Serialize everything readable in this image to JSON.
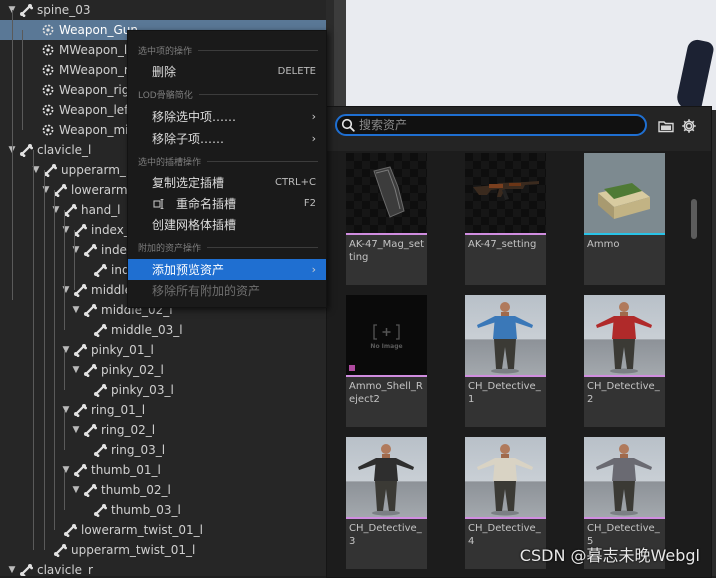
{
  "tree": {
    "rows": [
      {
        "label": "spine_03",
        "caret": "▼"
      },
      {
        "label": "Weapon_Gun",
        "caret": ""
      },
      {
        "label": "MWeapon_lef",
        "caret": ""
      },
      {
        "label": "MWeapon_mi",
        "caret": ""
      },
      {
        "label": "Weapon_right",
        "caret": ""
      },
      {
        "label": "Weapon_leftE",
        "caret": ""
      },
      {
        "label": "Weapon_midE",
        "caret": ""
      },
      {
        "label": "clavicle_l",
        "caret": "▼"
      },
      {
        "label": "upperarm_l",
        "caret": "▼"
      },
      {
        "label": "lowerarm",
        "caret": "▼"
      },
      {
        "label": "hand_l",
        "caret": "▼"
      },
      {
        "label": "index_",
        "caret": "▼"
      },
      {
        "label": "inde",
        "caret": "▼"
      },
      {
        "label": "ind",
        "caret": ""
      },
      {
        "label": "middle",
        "caret": "▼"
      },
      {
        "label": "middle_02_l",
        "caret": "▼"
      },
      {
        "label": "middle_03_l",
        "caret": ""
      },
      {
        "label": "pinky_01_l",
        "caret": "▼"
      },
      {
        "label": "pinky_02_l",
        "caret": "▼"
      },
      {
        "label": "pinky_03_l",
        "caret": ""
      },
      {
        "label": "ring_01_l",
        "caret": "▼"
      },
      {
        "label": "ring_02_l",
        "caret": "▼"
      },
      {
        "label": "ring_03_l",
        "caret": ""
      },
      {
        "label": "thumb_01_l",
        "caret": "▼"
      },
      {
        "label": "thumb_02_l",
        "caret": "▼"
      },
      {
        "label": "thumb_03_l",
        "caret": ""
      },
      {
        "label": "lowerarm_twist_01_l",
        "caret": ""
      },
      {
        "label": "upperarm_twist_01_l",
        "caret": ""
      },
      {
        "label": "clavicle_r",
        "caret": "▼"
      }
    ]
  },
  "context_menu": {
    "sections": [
      {
        "title": "选中项的操作"
      },
      {
        "title": "LOD骨骼简化"
      },
      {
        "title": "选中的插槽操作"
      },
      {
        "title": "附加的资产操作"
      }
    ],
    "items": [
      {
        "label": "删除",
        "shortcut": "DELETE",
        "arrow": ""
      },
      {
        "label": "移除选中项……",
        "shortcut": "",
        "arrow": "›"
      },
      {
        "label": "移除子项……",
        "shortcut": "",
        "arrow": "›"
      },
      {
        "label": "复制选定插槽",
        "shortcut": "CTRL+C",
        "arrow": ""
      },
      {
        "label": "重命名插槽",
        "shortcut": "F2",
        "arrow": ""
      },
      {
        "label": "创建网格体插槽",
        "shortcut": "",
        "arrow": ""
      },
      {
        "label": "添加预览资产",
        "shortcut": "",
        "arrow": "›"
      },
      {
        "label": "移除所有附加的资产",
        "shortcut": "",
        "arrow": ""
      }
    ]
  },
  "asset_picker": {
    "search": {
      "placeholder": "搜索资产",
      "value": ""
    },
    "icons": {
      "search": "search-icon",
      "folder": "folder-icon",
      "settings": "gear-icon"
    },
    "assets": [
      {
        "label": "AK-47_Mag_setting",
        "thumb": "magazine",
        "accent": "#d08de0"
      },
      {
        "label": "AK-47_setting",
        "thumb": "rifle",
        "accent": "#d08de0"
      },
      {
        "label": "Ammo",
        "thumb": "ammo-box",
        "accent": "#29c3e8"
      },
      {
        "label": "Ammo_Shell_Reject2",
        "thumb": "no-image",
        "accent": "#d08de0"
      },
      {
        "label": "CH_Detective_1",
        "thumb": "character",
        "accent": "#d08de0"
      },
      {
        "label": "CH_Detective_2",
        "thumb": "character",
        "accent": "#d08de0"
      },
      {
        "label": "CH_Detective_3",
        "thumb": "character",
        "accent": "#d08de0"
      },
      {
        "label": "CH_Detective_4",
        "thumb": "character",
        "accent": "#d08de0"
      },
      {
        "label": "CH_Detective_5",
        "thumb": "character",
        "accent": "#d08de0"
      }
    ],
    "no_image_text": "No Image"
  },
  "colors": {
    "accent_blue": "#1f6fd1",
    "selected_row": "#5a7896",
    "mesh_accent": "#d08de0",
    "static_accent": "#29c3e8"
  },
  "watermark": "CSDN @暮志未晚Webgl"
}
